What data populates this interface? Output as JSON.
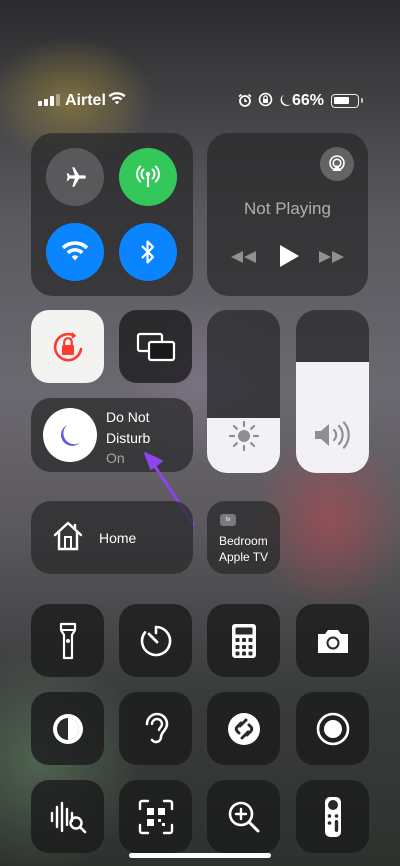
{
  "status_bar": {
    "carrier": "Airtel",
    "battery_percent": "66%",
    "battery_level": 0.66,
    "icons": [
      "signal-icon",
      "wifi-icon",
      "alarm-icon",
      "orientation-lock-icon",
      "moon-icon",
      "battery-icon"
    ]
  },
  "connectivity": {
    "airplane": {
      "icon": "airplane-icon",
      "on": false
    },
    "cellular": {
      "icon": "cellular-antenna-icon",
      "on": true,
      "color": "#34c759"
    },
    "wifi": {
      "icon": "wifi-icon",
      "on": true,
      "color": "#0a84ff"
    },
    "bluetooth": {
      "icon": "bluetooth-icon",
      "on": true,
      "color": "#0a84ff"
    }
  },
  "now_playing": {
    "title": "Not Playing",
    "icons": [
      "airplay-icon",
      "previous-track-icon",
      "play-icon",
      "next-track-icon"
    ]
  },
  "orientation_lock": {
    "icon": "rotation-lock-icon",
    "on": true,
    "color": "#ff3b30"
  },
  "screen_mirroring": {
    "icon": "screen-mirroring-icon"
  },
  "brightness": {
    "icon": "sun-icon",
    "level": 0.34
  },
  "volume": {
    "icon": "speaker-icon",
    "level": 0.68
  },
  "focus": {
    "line1": "Do Not",
    "line2": "Disturb",
    "state": "On",
    "icon": "moon-icon",
    "accent": "#5e5ce6"
  },
  "annotation": {
    "color": "#8e44ec",
    "icon": "arrow-annotation"
  },
  "home": {
    "label": "Home",
    "icon": "house-icon"
  },
  "apple_tv": {
    "line1": "Bedroom",
    "line2": "Apple TV",
    "badge": "tv"
  },
  "controls_row1": [
    "flashlight-icon",
    "timer-icon",
    "calculator-icon",
    "camera-icon"
  ],
  "controls_row2": [
    "dark-mode-icon",
    "hearing-icon",
    "shazam-icon",
    "screen-record-icon"
  ],
  "controls_row3": [
    "sound-recognition-icon",
    "qr-code-scanner-icon",
    "magnifier-icon",
    "apple-tv-remote-icon"
  ]
}
